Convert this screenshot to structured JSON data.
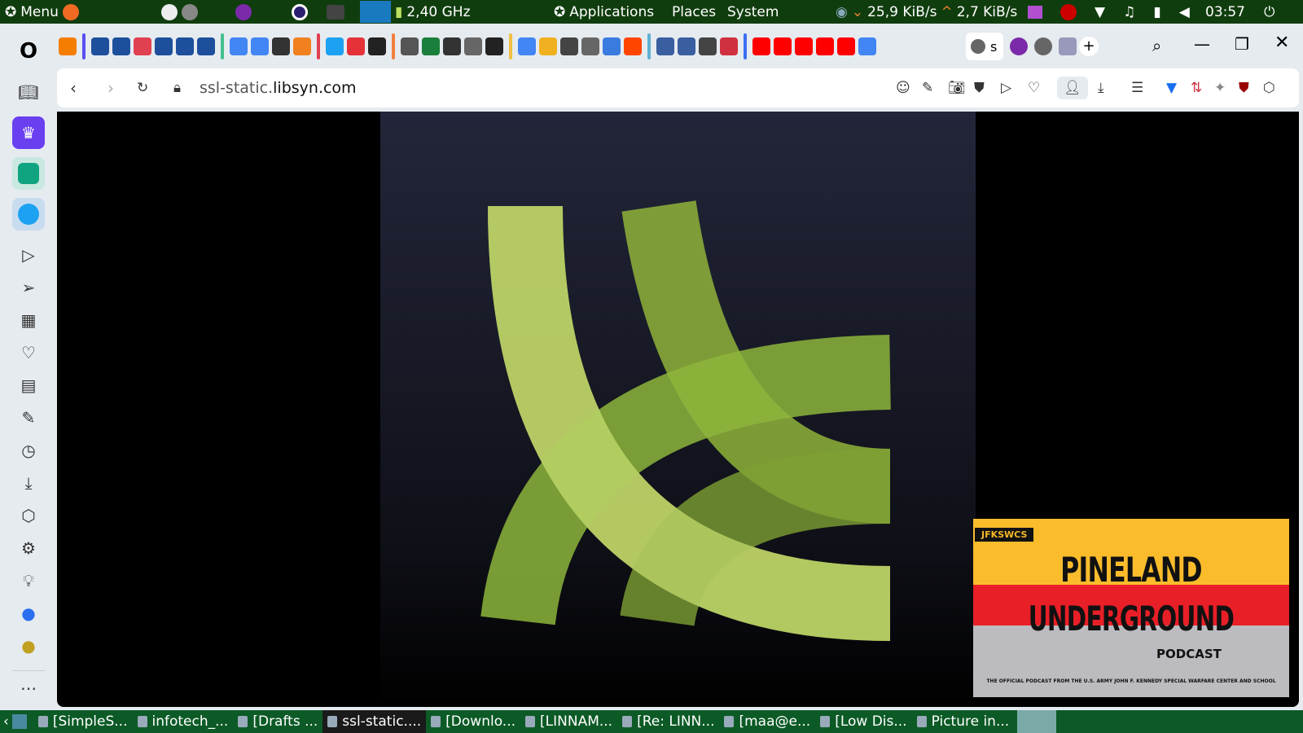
{
  "top_panel": {
    "menu": "Menu",
    "cpu": "2,40 GHz",
    "applications": "Applications",
    "places": "Places",
    "system": "System",
    "net_down": "25,9 KiB/s",
    "net_up": "2,7 KiB/s",
    "clock": "03:57"
  },
  "browser": {
    "url_prefix": "ssl-static.",
    "url_domain": "libsyn.com",
    "active_tab_label": "s",
    "tabs": [
      {
        "icon": "blogger-icon",
        "color": "#f57d00"
      },
      {
        "group": "#5a4ff0"
      },
      {
        "icon": "wave-icon",
        "color": "#1d4f9c"
      },
      {
        "icon": "wave-icon",
        "color": "#1d4f9c"
      },
      {
        "icon": "clock-icon",
        "color": "#e04050"
      },
      {
        "icon": "wave-icon",
        "color": "#1d4f9c"
      },
      {
        "icon": "wave-icon",
        "color": "#1d4f9c"
      },
      {
        "icon": "wave-icon",
        "color": "#1d4f9c"
      },
      {
        "group": "#45c090"
      },
      {
        "icon": "google-icon",
        "color": "#4285f4"
      },
      {
        "icon": "google-icon",
        "color": "#4285f4"
      },
      {
        "icon": "museum-icon",
        "color": "#333"
      },
      {
        "icon": "fox-icon",
        "color": "#f08020"
      },
      {
        "group": "#e04050"
      },
      {
        "icon": "twitter-icon",
        "color": "#1da1f2"
      },
      {
        "icon": "ebay-icon",
        "color": "#e53238"
      },
      {
        "icon": "script-icon",
        "color": "#222"
      },
      {
        "group": "#f08040"
      },
      {
        "icon": "p-icon",
        "color": "#555"
      },
      {
        "icon": "download-icon",
        "color": "#1a7f3a"
      },
      {
        "icon": "museum-icon",
        "color": "#333"
      },
      {
        "icon": "grid-icon",
        "color": "#666"
      },
      {
        "icon": "circle-icon",
        "color": "#222"
      },
      {
        "group": "#f0c040"
      },
      {
        "icon": "google-icon",
        "color": "#4285f4"
      },
      {
        "icon": "ring-icon",
        "color": "#f0b020"
      },
      {
        "icon": "wikipedia-icon",
        "color": "#444"
      },
      {
        "icon": "globe-icon",
        "color": "#666"
      },
      {
        "icon": "shield-icon",
        "color": "#3a7be0"
      },
      {
        "icon": "reddit-icon",
        "color": "#ff4500"
      },
      {
        "group": "#60b0d0"
      },
      {
        "icon": "list-icon",
        "color": "#3a5fa0"
      },
      {
        "icon": "list-icon",
        "color": "#3a5fa0"
      },
      {
        "icon": "wikipedia-icon",
        "color": "#444"
      },
      {
        "icon": "pm-icon",
        "color": "#d03040"
      },
      {
        "group": "#3a6ff0"
      },
      {
        "icon": "youtube-icon",
        "color": "#ff0000"
      },
      {
        "icon": "youtube-icon",
        "color": "#ff0000"
      },
      {
        "icon": "youtube-icon",
        "color": "#ff0000"
      },
      {
        "icon": "youtube-icon",
        "color": "#ff0000"
      },
      {
        "icon": "youtube-icon",
        "color": "#ff0000"
      },
      {
        "icon": "google-icon",
        "color": "#4285f4"
      }
    ]
  },
  "pip": {
    "badge": "JFKSWCS",
    "title1": "PINELAND",
    "title2": "UNDERGROUND",
    "subtitle": "PODCAST",
    "tagline": "THE OFFICIAL PODCAST FROM THE U.S. ARMY JOHN F. KENNEDY SPECIAL WARFARE CENTER AND SCHOOL"
  },
  "taskbar": [
    {
      "label": "[SimpleS..."
    },
    {
      "label": "infotech_..."
    },
    {
      "label": "[Drafts ..."
    },
    {
      "label": "ssl-static...."
    },
    {
      "label": "[Downlo..."
    },
    {
      "label": "[LINNAM..."
    },
    {
      "label": "[Re: LINN..."
    },
    {
      "label": "[maa@e..."
    },
    {
      "label": "[Low Dis..."
    },
    {
      "label": "Picture in..."
    }
  ]
}
